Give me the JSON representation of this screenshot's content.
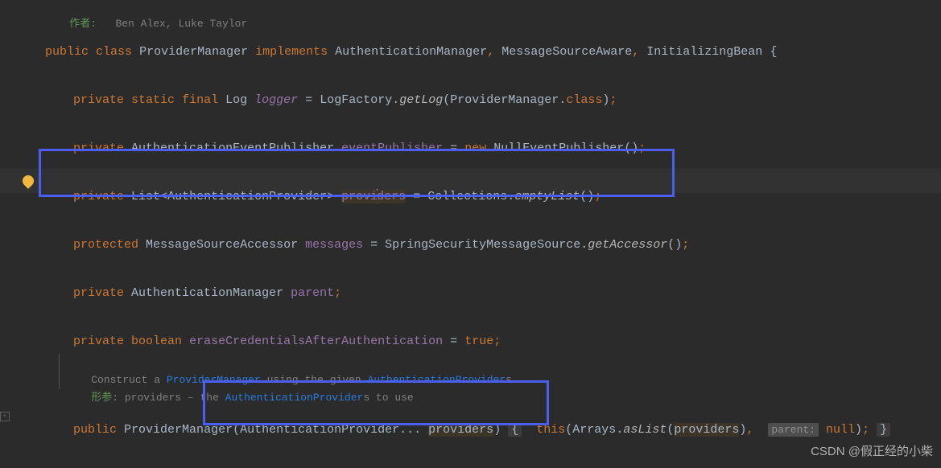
{
  "authors": {
    "label": "作者:",
    "names": "Ben Alex, Luke Taylor"
  },
  "code": {
    "classDecl": {
      "public": "public",
      "class": "class",
      "name": "ProviderManager",
      "implements": "implements",
      "iface1": "AuthenticationManager",
      "iface2": "MessageSourceAware",
      "iface3": "InitializingBean"
    },
    "logger": {
      "private": "private",
      "static": "static",
      "final": "final",
      "type": "Log",
      "name": "logger",
      "factory": "LogFactory",
      "method": "getLog",
      "arg": "ProviderManager",
      "classKw": "class"
    },
    "eventPub": {
      "private": "private",
      "type": "AuthenticationEventPublisher",
      "name": "eventPublisher",
      "new": "new",
      "impl": "NullEventPublisher"
    },
    "providers": {
      "private": "private",
      "type1": "List",
      "type2": "AuthenticationProvider",
      "name1": "provi",
      "name2": "ders",
      "coll": "Collections",
      "method": "emptyList"
    },
    "messages": {
      "protected": "protected",
      "type": "MessageSourceAccessor",
      "name": "messages",
      "src": "SpringSecurityMessageSource",
      "method": "getAccessor"
    },
    "parent": {
      "private": "private",
      "type": "AuthenticationManager",
      "name": "parent"
    },
    "erase": {
      "private": "private",
      "type": "boolean",
      "name": "eraseCredentialsAfterAuthentication",
      "val": "true"
    },
    "doc": {
      "l1a": "Construct a ",
      "l1b": "ProviderManager",
      "l1c": " using the given ",
      "l1d": "AuthenticationProvider",
      "l1e": "s",
      "l2a": "形参",
      "l2b": ": ",
      "l2c": "providers",
      "l2d": " – the ",
      "l2e": "AuthenticationProvider",
      "l2f": "s to use"
    },
    "ctor": {
      "public": "public",
      "name": "ProviderManager",
      "argType": "AuthenticationProvider",
      "argName": "providers",
      "this": "this",
      "arrays": "Arrays",
      "asList": "asList",
      "arg": "providers",
      "hint": "parent:",
      "null": "null"
    }
  },
  "watermark": "CSDN @假正经的小柴"
}
